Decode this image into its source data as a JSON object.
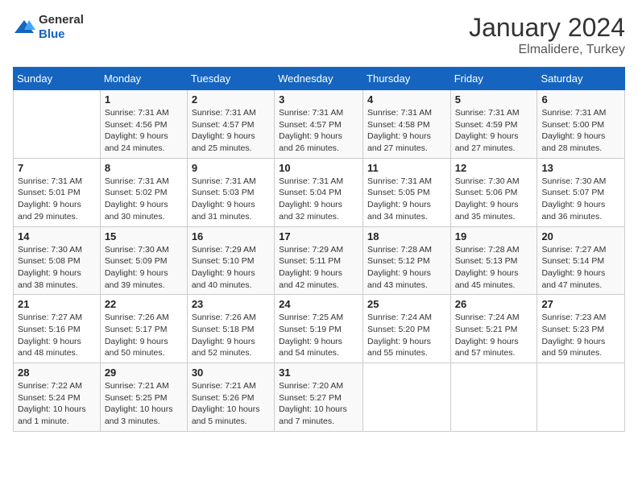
{
  "header": {
    "logo_general": "General",
    "logo_blue": "Blue",
    "month": "January 2024",
    "location": "Elmalidere, Turkey"
  },
  "days_of_week": [
    "Sunday",
    "Monday",
    "Tuesday",
    "Wednesday",
    "Thursday",
    "Friday",
    "Saturday"
  ],
  "weeks": [
    [
      {
        "day": "",
        "sunrise": "",
        "sunset": "",
        "daylight": ""
      },
      {
        "day": "1",
        "sunrise": "Sunrise: 7:31 AM",
        "sunset": "Sunset: 4:56 PM",
        "daylight": "Daylight: 9 hours and 24 minutes."
      },
      {
        "day": "2",
        "sunrise": "Sunrise: 7:31 AM",
        "sunset": "Sunset: 4:57 PM",
        "daylight": "Daylight: 9 hours and 25 minutes."
      },
      {
        "day": "3",
        "sunrise": "Sunrise: 7:31 AM",
        "sunset": "Sunset: 4:57 PM",
        "daylight": "Daylight: 9 hours and 26 minutes."
      },
      {
        "day": "4",
        "sunrise": "Sunrise: 7:31 AM",
        "sunset": "Sunset: 4:58 PM",
        "daylight": "Daylight: 9 hours and 27 minutes."
      },
      {
        "day": "5",
        "sunrise": "Sunrise: 7:31 AM",
        "sunset": "Sunset: 4:59 PM",
        "daylight": "Daylight: 9 hours and 27 minutes."
      },
      {
        "day": "6",
        "sunrise": "Sunrise: 7:31 AM",
        "sunset": "Sunset: 5:00 PM",
        "daylight": "Daylight: 9 hours and 28 minutes."
      }
    ],
    [
      {
        "day": "7",
        "sunrise": "Sunrise: 7:31 AM",
        "sunset": "Sunset: 5:01 PM",
        "daylight": "Daylight: 9 hours and 29 minutes."
      },
      {
        "day": "8",
        "sunrise": "Sunrise: 7:31 AM",
        "sunset": "Sunset: 5:02 PM",
        "daylight": "Daylight: 9 hours and 30 minutes."
      },
      {
        "day": "9",
        "sunrise": "Sunrise: 7:31 AM",
        "sunset": "Sunset: 5:03 PM",
        "daylight": "Daylight: 9 hours and 31 minutes."
      },
      {
        "day": "10",
        "sunrise": "Sunrise: 7:31 AM",
        "sunset": "Sunset: 5:04 PM",
        "daylight": "Daylight: 9 hours and 32 minutes."
      },
      {
        "day": "11",
        "sunrise": "Sunrise: 7:31 AM",
        "sunset": "Sunset: 5:05 PM",
        "daylight": "Daylight: 9 hours and 34 minutes."
      },
      {
        "day": "12",
        "sunrise": "Sunrise: 7:30 AM",
        "sunset": "Sunset: 5:06 PM",
        "daylight": "Daylight: 9 hours and 35 minutes."
      },
      {
        "day": "13",
        "sunrise": "Sunrise: 7:30 AM",
        "sunset": "Sunset: 5:07 PM",
        "daylight": "Daylight: 9 hours and 36 minutes."
      }
    ],
    [
      {
        "day": "14",
        "sunrise": "Sunrise: 7:30 AM",
        "sunset": "Sunset: 5:08 PM",
        "daylight": "Daylight: 9 hours and 38 minutes."
      },
      {
        "day": "15",
        "sunrise": "Sunrise: 7:30 AM",
        "sunset": "Sunset: 5:09 PM",
        "daylight": "Daylight: 9 hours and 39 minutes."
      },
      {
        "day": "16",
        "sunrise": "Sunrise: 7:29 AM",
        "sunset": "Sunset: 5:10 PM",
        "daylight": "Daylight: 9 hours and 40 minutes."
      },
      {
        "day": "17",
        "sunrise": "Sunrise: 7:29 AM",
        "sunset": "Sunset: 5:11 PM",
        "daylight": "Daylight: 9 hours and 42 minutes."
      },
      {
        "day": "18",
        "sunrise": "Sunrise: 7:28 AM",
        "sunset": "Sunset: 5:12 PM",
        "daylight": "Daylight: 9 hours and 43 minutes."
      },
      {
        "day": "19",
        "sunrise": "Sunrise: 7:28 AM",
        "sunset": "Sunset: 5:13 PM",
        "daylight": "Daylight: 9 hours and 45 minutes."
      },
      {
        "day": "20",
        "sunrise": "Sunrise: 7:27 AM",
        "sunset": "Sunset: 5:14 PM",
        "daylight": "Daylight: 9 hours and 47 minutes."
      }
    ],
    [
      {
        "day": "21",
        "sunrise": "Sunrise: 7:27 AM",
        "sunset": "Sunset: 5:16 PM",
        "daylight": "Daylight: 9 hours and 48 minutes."
      },
      {
        "day": "22",
        "sunrise": "Sunrise: 7:26 AM",
        "sunset": "Sunset: 5:17 PM",
        "daylight": "Daylight: 9 hours and 50 minutes."
      },
      {
        "day": "23",
        "sunrise": "Sunrise: 7:26 AM",
        "sunset": "Sunset: 5:18 PM",
        "daylight": "Daylight: 9 hours and 52 minutes."
      },
      {
        "day": "24",
        "sunrise": "Sunrise: 7:25 AM",
        "sunset": "Sunset: 5:19 PM",
        "daylight": "Daylight: 9 hours and 54 minutes."
      },
      {
        "day": "25",
        "sunrise": "Sunrise: 7:24 AM",
        "sunset": "Sunset: 5:20 PM",
        "daylight": "Daylight: 9 hours and 55 minutes."
      },
      {
        "day": "26",
        "sunrise": "Sunrise: 7:24 AM",
        "sunset": "Sunset: 5:21 PM",
        "daylight": "Daylight: 9 hours and 57 minutes."
      },
      {
        "day": "27",
        "sunrise": "Sunrise: 7:23 AM",
        "sunset": "Sunset: 5:23 PM",
        "daylight": "Daylight: 9 hours and 59 minutes."
      }
    ],
    [
      {
        "day": "28",
        "sunrise": "Sunrise: 7:22 AM",
        "sunset": "Sunset: 5:24 PM",
        "daylight": "Daylight: 10 hours and 1 minute."
      },
      {
        "day": "29",
        "sunrise": "Sunrise: 7:21 AM",
        "sunset": "Sunset: 5:25 PM",
        "daylight": "Daylight: 10 hours and 3 minutes."
      },
      {
        "day": "30",
        "sunrise": "Sunrise: 7:21 AM",
        "sunset": "Sunset: 5:26 PM",
        "daylight": "Daylight: 10 hours and 5 minutes."
      },
      {
        "day": "31",
        "sunrise": "Sunrise: 7:20 AM",
        "sunset": "Sunset: 5:27 PM",
        "daylight": "Daylight: 10 hours and 7 minutes."
      },
      {
        "day": "",
        "sunrise": "",
        "sunset": "",
        "daylight": ""
      },
      {
        "day": "",
        "sunrise": "",
        "sunset": "",
        "daylight": ""
      },
      {
        "day": "",
        "sunrise": "",
        "sunset": "",
        "daylight": ""
      }
    ]
  ]
}
